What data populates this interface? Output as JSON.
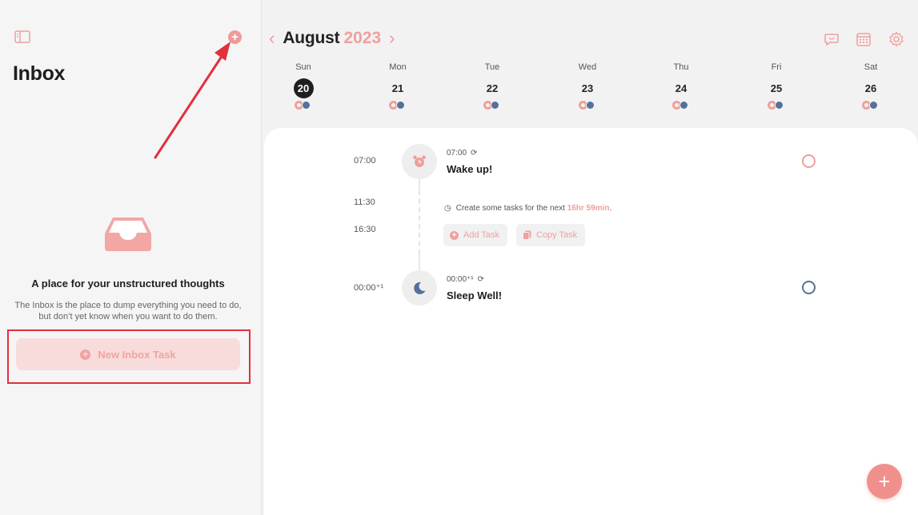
{
  "colors": {
    "accent": "#ef9f9b",
    "night": "#55719b",
    "highlight": "#e2303a"
  },
  "sidebar": {
    "title": "Inbox",
    "empty_heading": "A place for your unstructured thoughts",
    "empty_description": "The Inbox is the place to dump everything you need to do, but don’t yet know when you want to do them.",
    "new_task_label": "New Inbox Task",
    "icons": {
      "toggle": "sidebar-toggle-icon",
      "add": "plus-circle-icon",
      "empty": "inbox-tray-icon"
    }
  },
  "header": {
    "month": "August",
    "year": "2023",
    "icons": [
      "chat-icon",
      "calendar-icon",
      "gear-icon"
    ]
  },
  "week": {
    "days": [
      {
        "name": "Sun",
        "date": "20",
        "today": true
      },
      {
        "name": "Mon",
        "date": "21"
      },
      {
        "name": "Tue",
        "date": "22"
      },
      {
        "name": "Wed",
        "date": "23"
      },
      {
        "name": "Thu",
        "date": "24"
      },
      {
        "name": "Fri",
        "date": "25"
      },
      {
        "name": "Sat",
        "date": "26"
      }
    ]
  },
  "timeline": {
    "times": {
      "t1": "07:00",
      "t2": "11:30",
      "t3": "16:30",
      "t4": "00:00⁺¹"
    },
    "wake": {
      "time": "07:00",
      "title": "Wake up!",
      "icon": "alarm-clock-icon"
    },
    "gap": {
      "hint_prefix": "Create some tasks for the next",
      "hint_highlight": "16hr 59min",
      "hint_suffix": ".",
      "add_label": "Add Task",
      "copy_label": "Copy Task"
    },
    "sleep": {
      "time": "00:00⁺¹",
      "title": "Sleep Well!",
      "icon": "moon-icon"
    }
  },
  "fab_label": "+"
}
